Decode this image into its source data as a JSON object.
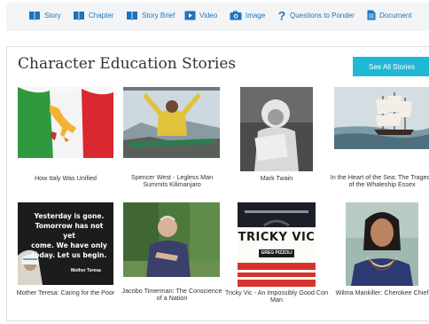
{
  "nav": [
    {
      "label": "Story",
      "icon": "book-icon"
    },
    {
      "label": "Chapter",
      "icon": "book-icon"
    },
    {
      "label": "Story Brief",
      "icon": "book-icon"
    },
    {
      "label": "Video",
      "icon": "video-icon"
    },
    {
      "label": "Image",
      "icon": "camera-icon"
    },
    {
      "label": "Questions to Ponder",
      "icon": "question-icon"
    },
    {
      "label": "Document",
      "icon": "document-icon"
    }
  ],
  "panel": {
    "title": "Character Education Stories",
    "see_all_label": "See All Stories"
  },
  "stories": [
    {
      "title": "How Italy Was Unified"
    },
    {
      "title": "Spencer West - Legless Man Summits Kilimanjaro"
    },
    {
      "title": "Mark Twain"
    },
    {
      "title": "In the Heart of the Sea: The Tragedy of the Whaleship Essex"
    },
    {
      "title": "Mother Teresa: Caring for the Poor",
      "image_text": [
        "Yesterday is gone.",
        "Tomorrow has not yet",
        "come. We have only",
        "today. Let us begin."
      ],
      "image_credit": "Mother Teresa"
    },
    {
      "title": "Jacobo Timerman: The Conscience of a Nation"
    },
    {
      "title": "Tricky Vic - An Impossibly Good Con Man",
      "image_text": [
        "TRICKY VIC"
      ],
      "image_credit": "GREG PIZZOLI"
    },
    {
      "title": "Wilma Mankiller: Cherokee Chief"
    }
  ],
  "colors": {
    "accent": "#1fb9d6",
    "nav_link": "#1e73be",
    "nav_bg": "#f3f4f6"
  }
}
